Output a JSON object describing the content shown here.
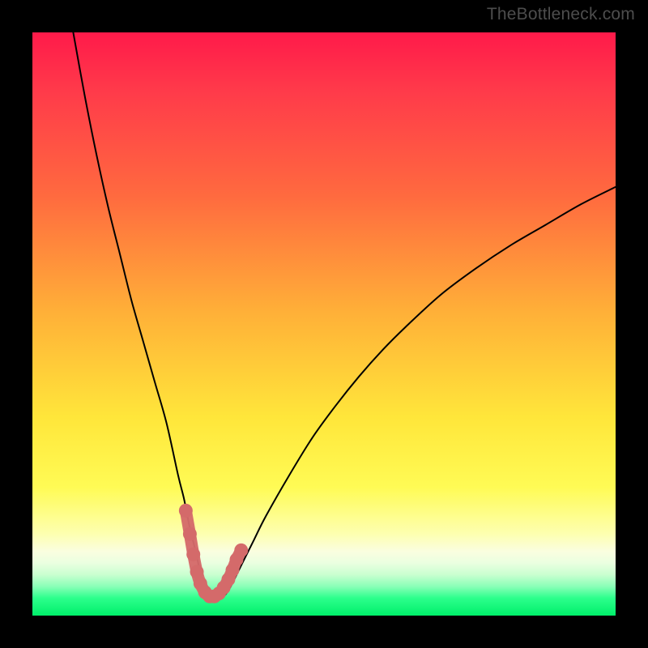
{
  "watermark": "TheBottleneck.com",
  "colors": {
    "frame": "#000000",
    "curve_stroke": "#000000",
    "marker_stroke": "#d46a6a",
    "marker_fill": "#d46a6a"
  },
  "chart_data": {
    "type": "line",
    "title": "",
    "xlabel": "",
    "ylabel": "",
    "xlim": [
      0,
      100
    ],
    "ylim": [
      0,
      100
    ],
    "grid": false,
    "legend": false,
    "annotations": [],
    "series": [
      {
        "name": "curve",
        "x": [
          7,
          9,
          11,
          13,
          15,
          17,
          19,
          21,
          23,
          25,
          26,
          27,
          28,
          29,
          30,
          31,
          32,
          33,
          34,
          36,
          38,
          40,
          44,
          48,
          52,
          56,
          60,
          64,
          70,
          76,
          82,
          88,
          94,
          100
        ],
        "y": [
          100,
          89,
          79,
          70,
          62,
          54,
          47,
          40,
          33,
          24,
          20,
          15,
          11,
          6.5,
          4,
          3,
          3,
          3.5,
          5,
          9,
          13,
          17,
          24,
          30.5,
          36,
          41,
          45.5,
          49.5,
          55,
          59.5,
          63.5,
          67,
          70.5,
          73.5
        ]
      },
      {
        "name": "markers",
        "x": [
          26.3,
          27.0,
          27.6,
          28.2,
          28.8,
          29.6,
          30.4,
          31.2,
          32.0,
          32.8,
          33.6,
          34.3,
          35.0,
          35.8
        ],
        "y": [
          18.0,
          14.0,
          10.5,
          7.5,
          5.5,
          4.0,
          3.3,
          3.3,
          3.8,
          4.8,
          6.2,
          7.8,
          9.6,
          11.2
        ]
      }
    ]
  }
}
